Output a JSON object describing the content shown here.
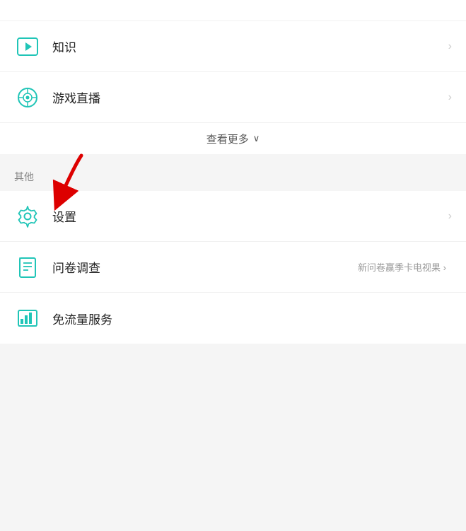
{
  "menu": {
    "top_partial_text": "",
    "items_top": [
      {
        "id": "knowledge",
        "label": "知识",
        "icon": "knowledge",
        "has_chevron": true,
        "badge": ""
      },
      {
        "id": "game_live",
        "label": "游戏直播",
        "icon": "game",
        "has_chevron": true,
        "badge": ""
      }
    ],
    "view_more": {
      "label": "查看更多",
      "chevron": "∨"
    },
    "section_other": {
      "title": "其他"
    },
    "items_bottom": [
      {
        "id": "settings",
        "label": "设置",
        "icon": "settings",
        "has_chevron": true,
        "badge": ""
      },
      {
        "id": "survey",
        "label": "问卷调查",
        "icon": "survey",
        "has_chevron": true,
        "badge": "新问卷赢季卡电视果 ›"
      },
      {
        "id": "free_traffic",
        "label": "免流量服务",
        "icon": "free_traffic",
        "has_chevron": false,
        "badge": ""
      }
    ]
  }
}
